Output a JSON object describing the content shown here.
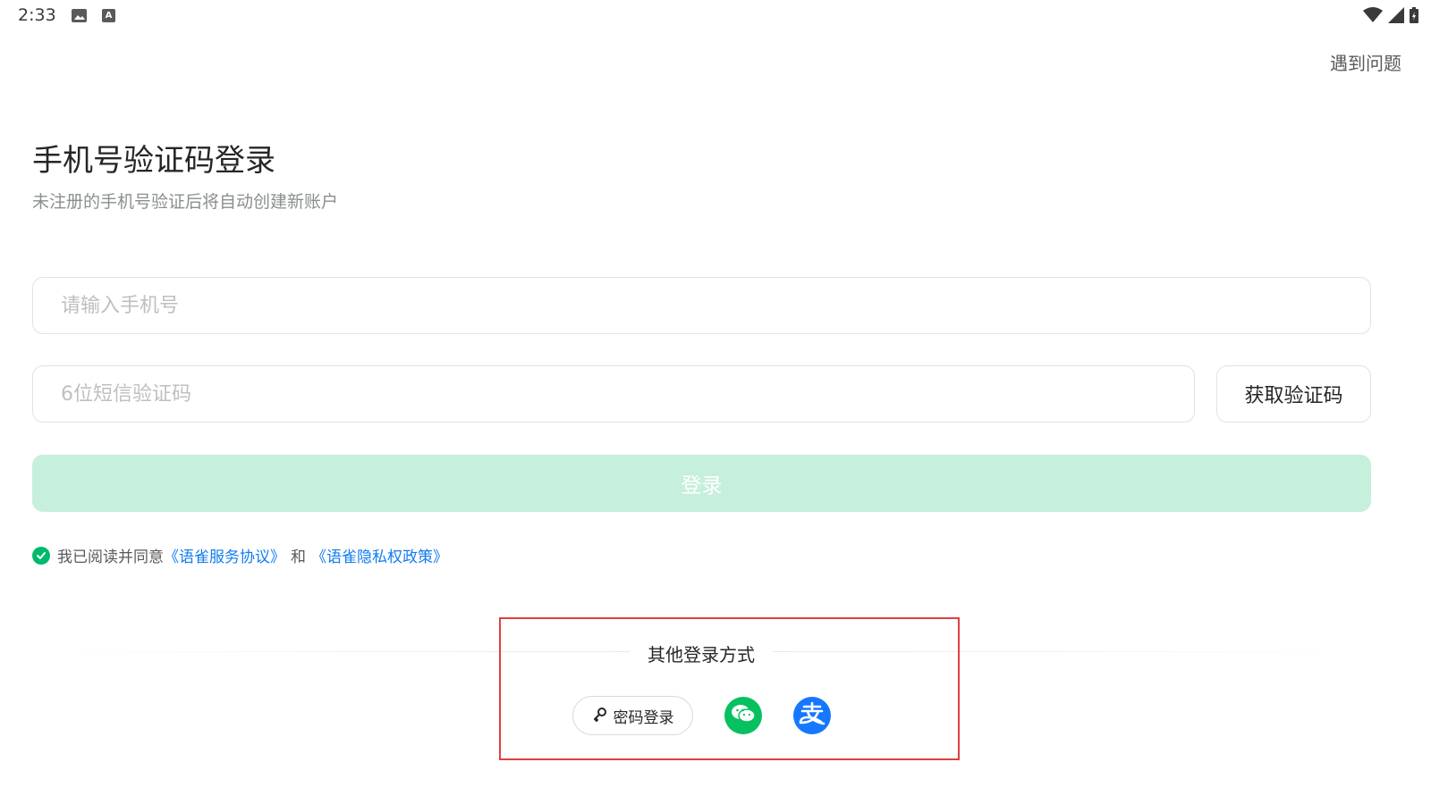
{
  "status_bar": {
    "time": "2:33",
    "icons": [
      "image-icon",
      "a-keyboard-icon",
      "wifi-icon",
      "cell-signal-icon",
      "battery-icon"
    ]
  },
  "header": {
    "help_link": "遇到问题"
  },
  "login": {
    "title": "手机号验证码登录",
    "subtitle": "未注册的手机号验证后将自动创建新账户",
    "phone_placeholder": "请输入手机号",
    "code_placeholder": "6位短信验证码",
    "get_code_label": "获取验证码",
    "submit_label": "登录"
  },
  "agreement": {
    "checked": true,
    "prefix": "我已阅读并同意",
    "service_link": "《语雀服务协议》",
    "and_text": "和",
    "privacy_link": "《语雀隐私权政策》"
  },
  "other_login": {
    "title": "其他登录方式",
    "password_login_label": "密码登录",
    "methods": [
      "key-icon",
      "wechat-icon",
      "alipay-icon"
    ]
  },
  "colors": {
    "brand_green": "#00b96b",
    "login_button_disabled": "#c6efdc",
    "link_blue": "#117cee",
    "wechat_green": "#07c160",
    "alipay_blue": "#1677ff",
    "highlight_red": "#e0403f"
  }
}
